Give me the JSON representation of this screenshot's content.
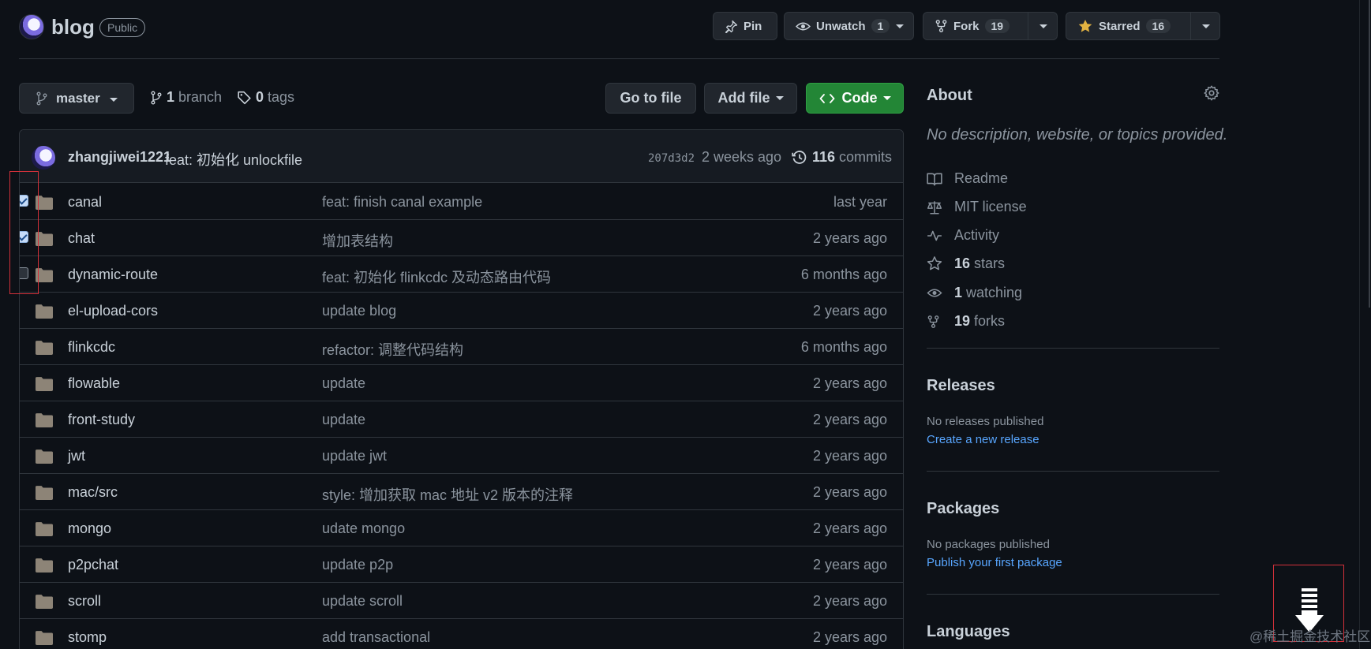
{
  "repo": {
    "name": "blog",
    "visibility": "Public",
    "pin_label": "Pin",
    "watch_label": "Unwatch",
    "watch_count": "1",
    "fork_label": "Fork",
    "fork_count": "19",
    "star_label": "Starred",
    "star_count": "16"
  },
  "toolbar": {
    "branch_name": "master",
    "branch_count": "1",
    "branch_label": "branch",
    "tag_count": "0",
    "tag_label": "tags",
    "go_to_file": "Go to file",
    "add_file": "Add file",
    "code": "Code"
  },
  "commit": {
    "author": "zhangjiwei1221",
    "message": "feat: 初始化 unlockfile",
    "sha": "207d3d2",
    "time": "2 weeks ago",
    "count": "116",
    "count_label": "commits"
  },
  "files": [
    {
      "name": "canal",
      "message": "feat: finish canal example",
      "age": "last year",
      "checked": true
    },
    {
      "name": "chat",
      "message": "增加表结构",
      "age": "2 years ago",
      "checked": true
    },
    {
      "name": "dynamic-route",
      "message": "feat: 初始化 flinkcdc 及动态路由代码",
      "age": "6 months ago",
      "checked": false
    },
    {
      "name": "el-upload-cors",
      "message": "update blog",
      "age": "2 years ago"
    },
    {
      "name": "flinkcdc",
      "message": "refactor: 调整代码结构",
      "age": "6 months ago"
    },
    {
      "name": "flowable",
      "message": "update",
      "age": "2 years ago"
    },
    {
      "name": "front-study",
      "message": "update",
      "age": "2 years ago"
    },
    {
      "name": "jwt",
      "message": "update jwt",
      "age": "2 years ago"
    },
    {
      "name": "mac/src",
      "message": "style: 增加获取 mac 地址 v2 版本的注释",
      "age": "2 years ago"
    },
    {
      "name": "mongo",
      "message": "udate mongo",
      "age": "2 years ago"
    },
    {
      "name": "p2pchat",
      "message": "update p2p",
      "age": "2 years ago"
    },
    {
      "name": "scroll",
      "message": "update scroll",
      "age": "2 years ago"
    },
    {
      "name": "stomp",
      "message": "add transactional",
      "age": "2 years ago"
    }
  ],
  "about": {
    "title": "About",
    "description": "No description, website, or topics provided.",
    "readme": "Readme",
    "license": "MIT license",
    "activity": "Activity",
    "stars_count": "16",
    "stars_label": "stars",
    "watching_count": "1",
    "watching_label": "watching",
    "forks_count": "19",
    "forks_label": "forks"
  },
  "releases": {
    "title": "Releases",
    "note": "No releases published",
    "link": "Create a new release"
  },
  "packages": {
    "title": "Packages",
    "note": "No packages published",
    "link": "Publish your first package"
  },
  "languages": {
    "title": "Languages"
  },
  "watermark": "@稀土掘金技术社区",
  "colors": {
    "background": "#0d1117",
    "border": "#30363d",
    "code_button": "#238636",
    "link": "#58a6ff",
    "star_icon": "#e3b341",
    "annotation_box": "#d3313a"
  }
}
